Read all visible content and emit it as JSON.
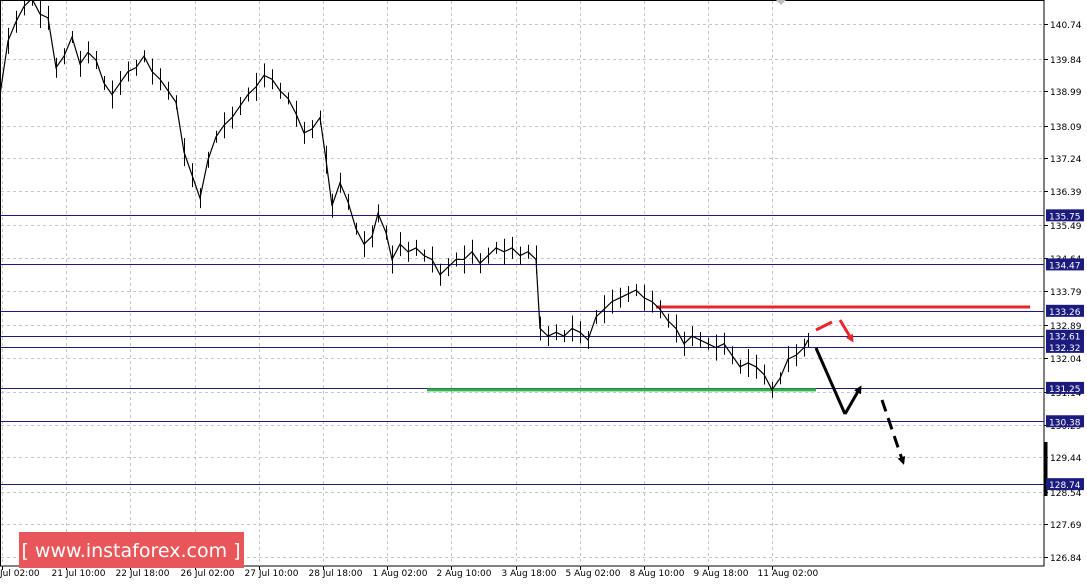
{
  "chart_data": {
    "type": "line",
    "title": "",
    "xlabel": "",
    "ylabel": "",
    "grid": true,
    "ylim": [
      126.84,
      141.45
    ],
    "x_tick_labels": [
      "Jul 02:00",
      "21 Jul 10:00",
      "22 Jul 18:00",
      "26 Jul 02:00",
      "27 Jul 10:00",
      "28 Jul 18:00",
      "1 Aug 02:00",
      "2 Aug 10:00",
      "3 Aug 18:00",
      "5 Aug 02:00",
      "8 Aug 10:00",
      "9 Aug 18:00",
      "11 Aug 02:00"
    ],
    "y_tick_values": [
      140.74,
      139.84,
      138.99,
      138.09,
      137.24,
      136.39,
      135.49,
      134.64,
      133.79,
      132.89,
      132.04,
      131.14,
      130.29,
      129.44,
      128.54,
      127.69,
      126.84
    ],
    "series": [
      {
        "values": [
          [
            0,
            138.9
          ],
          [
            8,
            140.3
          ],
          [
            16,
            140.8
          ],
          [
            24,
            141.2
          ],
          [
            32,
            141.4
          ],
          [
            40,
            141.0
          ],
          [
            48,
            140.9
          ],
          [
            56,
            139.6
          ],
          [
            64,
            139.9
          ],
          [
            72,
            140.4
          ],
          [
            80,
            139.7
          ],
          [
            88,
            140.0
          ],
          [
            96,
            139.8
          ],
          [
            104,
            139.2
          ],
          [
            112,
            138.9
          ],
          [
            120,
            139.2
          ],
          [
            128,
            139.5
          ],
          [
            136,
            139.6
          ],
          [
            144,
            139.9
          ],
          [
            152,
            139.5
          ],
          [
            160,
            139.3
          ],
          [
            168,
            139.0
          ],
          [
            176,
            138.7
          ],
          [
            184,
            137.4
          ],
          [
            192,
            136.8
          ],
          [
            200,
            136.2
          ],
          [
            208,
            137.2
          ],
          [
            216,
            137.8
          ],
          [
            224,
            138.1
          ],
          [
            232,
            138.3
          ],
          [
            240,
            138.6
          ],
          [
            248,
            138.9
          ],
          [
            256,
            139.1
          ],
          [
            264,
            139.4
          ],
          [
            272,
            139.3
          ],
          [
            280,
            139.0
          ],
          [
            288,
            138.8
          ],
          [
            296,
            138.4
          ],
          [
            304,
            137.9
          ],
          [
            312,
            138.0
          ],
          [
            320,
            138.3
          ],
          [
            326,
            137.2
          ],
          [
            332,
            136.0
          ],
          [
            340,
            136.6
          ],
          [
            348,
            136.1
          ],
          [
            356,
            135.4
          ],
          [
            364,
            135.0
          ],
          [
            372,
            135.2
          ],
          [
            378,
            135.8
          ],
          [
            386,
            135.3
          ],
          [
            392,
            134.6
          ],
          [
            400,
            135.0
          ],
          [
            408,
            134.8
          ],
          [
            416,
            134.9
          ],
          [
            424,
            134.7
          ],
          [
            432,
            134.6
          ],
          [
            440,
            134.2
          ],
          [
            448,
            134.4
          ],
          [
            456,
            134.6
          ],
          [
            464,
            134.6
          ],
          [
            472,
            134.8
          ],
          [
            480,
            134.5
          ],
          [
            488,
            134.7
          ],
          [
            496,
            134.9
          ],
          [
            504,
            134.8
          ],
          [
            512,
            134.9
          ],
          [
            520,
            134.7
          ],
          [
            528,
            134.8
          ],
          [
            536,
            134.6
          ],
          [
            540,
            132.8
          ],
          [
            548,
            132.6
          ],
          [
            556,
            132.7
          ],
          [
            564,
            132.6
          ],
          [
            572,
            132.8
          ],
          [
            580,
            132.7
          ],
          [
            588,
            132.5
          ],
          [
            596,
            133.1
          ],
          [
            604,
            133.3
          ],
          [
            612,
            133.5
          ],
          [
            620,
            133.6
          ],
          [
            628,
            133.7
          ],
          [
            636,
            133.8
          ],
          [
            644,
            133.6
          ],
          [
            652,
            133.5
          ],
          [
            660,
            133.3
          ],
          [
            668,
            133.0
          ],
          [
            676,
            132.8
          ],
          [
            684,
            132.4
          ],
          [
            692,
            132.6
          ],
          [
            700,
            132.5
          ],
          [
            708,
            132.4
          ],
          [
            716,
            132.3
          ],
          [
            724,
            132.4
          ],
          [
            732,
            132.1
          ],
          [
            740,
            131.8
          ],
          [
            748,
            131.9
          ],
          [
            756,
            131.8
          ],
          [
            764,
            131.6
          ],
          [
            772,
            131.2
          ],
          [
            780,
            131.5
          ],
          [
            788,
            132.0
          ],
          [
            796,
            132.1
          ],
          [
            804,
            132.3
          ],
          [
            808,
            132.5
          ]
        ]
      }
    ],
    "levels": [
      135.75,
      134.47,
      133.26,
      132.61,
      132.32,
      131.25,
      130.38,
      128.74
    ],
    "level_labels": [
      "135.75",
      "134.47",
      "133.26",
      "132.61",
      "132.32",
      "131.25",
      "130.38",
      "128.74"
    ],
    "resistance_line": 133.36,
    "support_line": 131.25,
    "colors": {
      "price": "#000000",
      "grid": "#c6c6c6",
      "level": "#1b1b7e",
      "level_label_bg": "#1b1b7e",
      "level_label_text": "#ffffff",
      "resistance": "#e8262c",
      "support": "#2fb34a",
      "forecast_dark": "#000000",
      "forecast_red": "#e8262c",
      "watermark_bg": "#e9565a"
    },
    "watermark_text": "[ www.instaforex.com ]"
  }
}
